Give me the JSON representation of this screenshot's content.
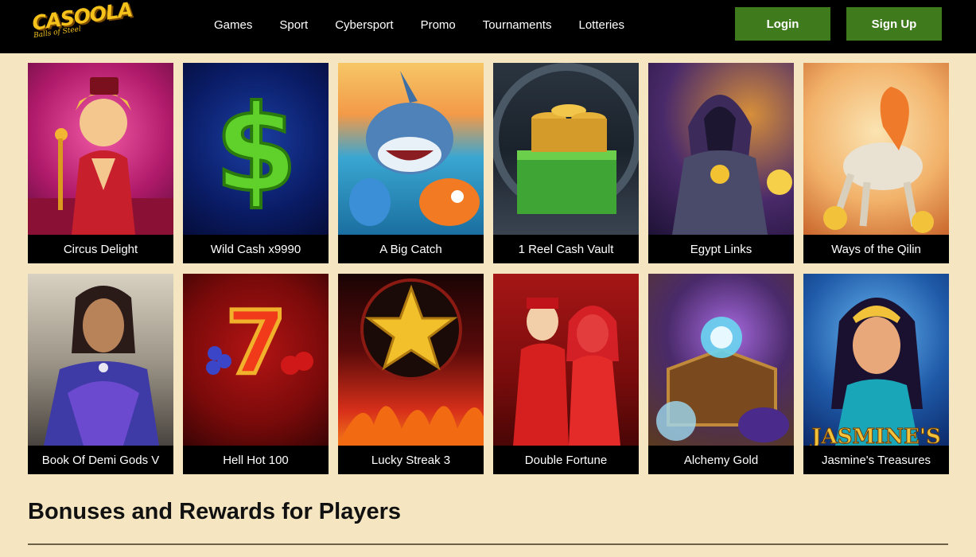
{
  "header": {
    "logo_text": "CASOOLA",
    "logo_tagline": "Balls of Steel",
    "nav": [
      {
        "label": "Games"
      },
      {
        "label": "Sport"
      },
      {
        "label": "Cybersport"
      },
      {
        "label": "Promo"
      },
      {
        "label": "Tournaments"
      },
      {
        "label": "Lotteries"
      }
    ],
    "login_label": "Login",
    "signup_label": "Sign Up"
  },
  "games": [
    {
      "title": "Circus Delight"
    },
    {
      "title": "Wild Cash x9990"
    },
    {
      "title": "A Big Catch"
    },
    {
      "title": "1 Reel Cash Vault"
    },
    {
      "title": "Egypt Links"
    },
    {
      "title": "Ways of the Qilin"
    },
    {
      "title": "Book Of Demi Gods V"
    },
    {
      "title": "Hell Hot 100"
    },
    {
      "title": "Lucky Streak 3"
    },
    {
      "title": "Double Fortune"
    },
    {
      "title": "Alchemy Gold"
    },
    {
      "title": "Jasmine's Treasures",
      "art_text": "JASMINE'S"
    }
  ],
  "section": {
    "title": "Bonuses and Rewards for Players"
  },
  "colors": {
    "page_bg": "#f5e6c1",
    "header_bg": "#000000",
    "button_green": "#3f7a1c",
    "logo_yellow": "#f4c21b"
  }
}
